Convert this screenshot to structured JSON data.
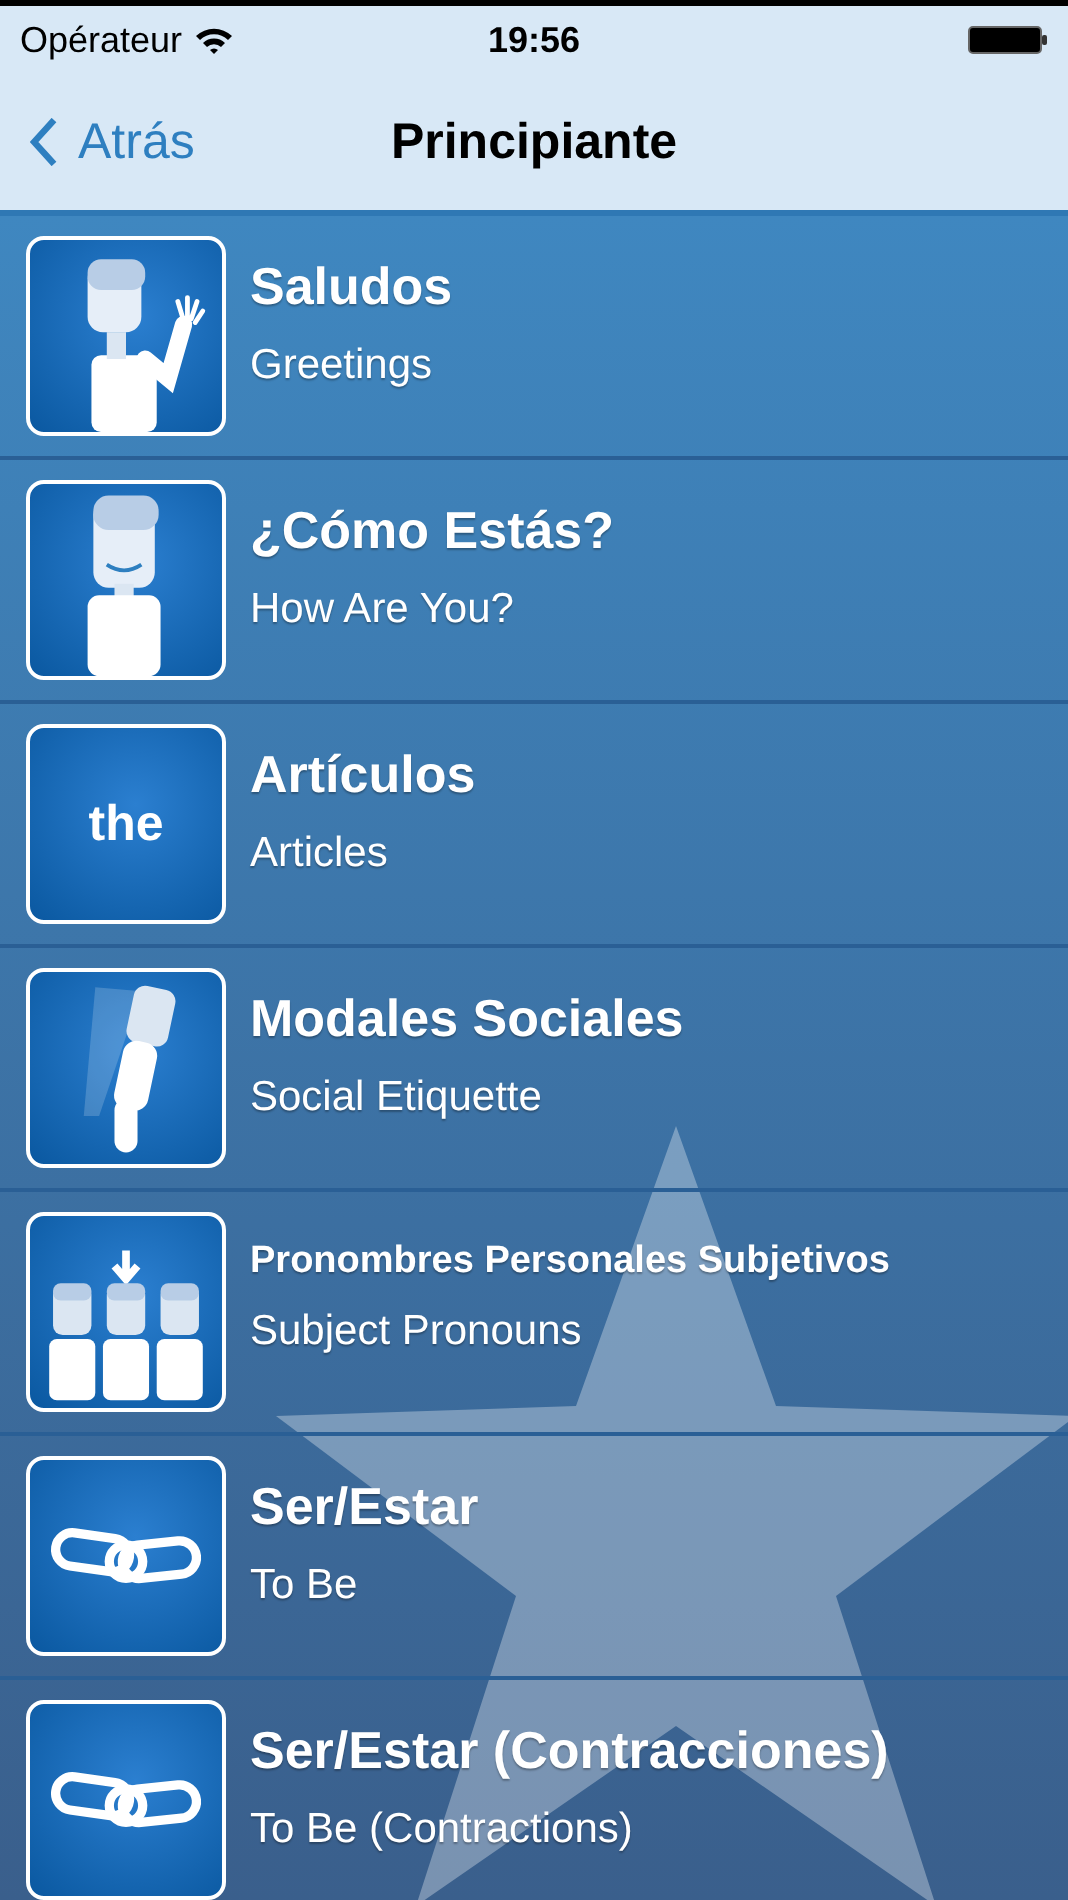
{
  "status_bar": {
    "carrier": "Opérateur",
    "time": "19:56"
  },
  "nav_bar": {
    "back": "Atrás",
    "title": "Principiante"
  },
  "lessons": [
    {
      "title": "Saludos",
      "subtitle": "Greetings",
      "kind": "waving-person"
    },
    {
      "title": "¿Cómo Estás?",
      "subtitle": "How Are You?",
      "kind": "smiling-person"
    },
    {
      "title": "Artículos",
      "subtitle": "Articles",
      "kind": "word",
      "icon_text": "the"
    },
    {
      "title": "Modales Sociales",
      "subtitle": "Social Etiquette",
      "kind": "bowing-person"
    },
    {
      "title": "Pronombres Personales Subjetivos",
      "subtitle": "Subject Pronouns",
      "kind": "group"
    },
    {
      "title": "Ser/Estar",
      "subtitle": "To Be",
      "kind": "chain"
    },
    {
      "title": "Ser/Estar (Contracciones)",
      "subtitle": "To Be (Contractions)",
      "kind": "chain"
    }
  ]
}
